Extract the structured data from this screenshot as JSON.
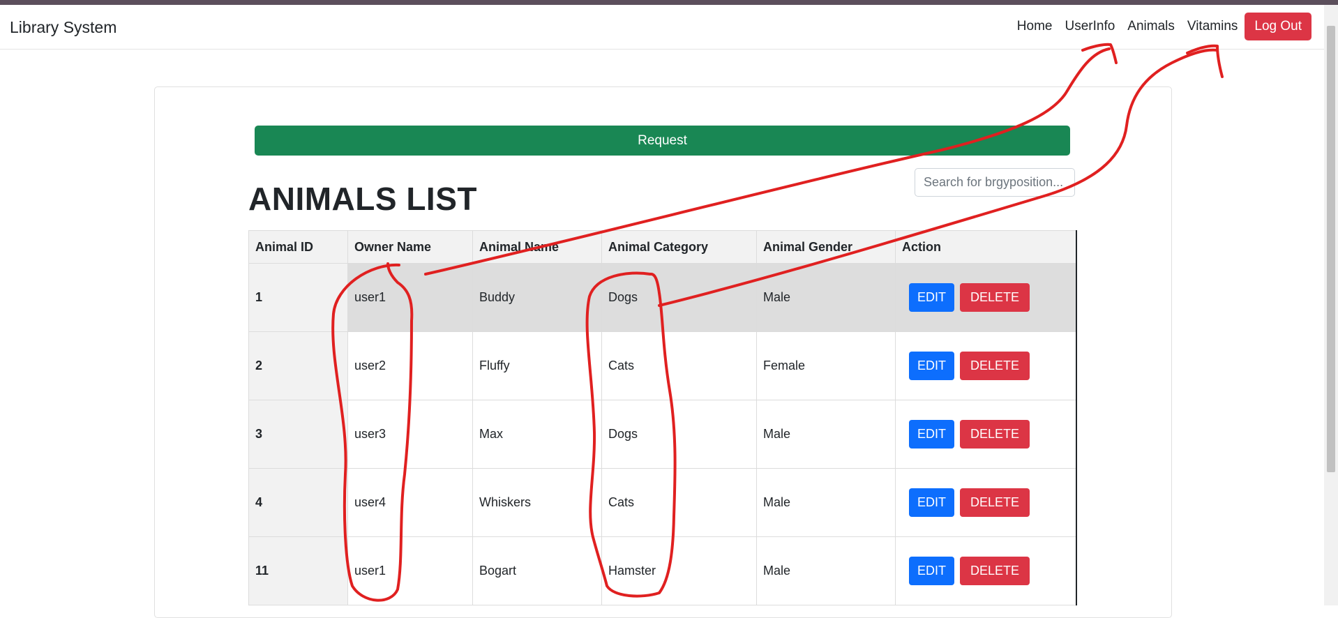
{
  "app": {
    "brand": "Library System"
  },
  "nav": {
    "links": [
      "Home",
      "UserInfo",
      "Animals",
      "Vitamins"
    ],
    "logout_label": "Log Out"
  },
  "main": {
    "request_label": "Request",
    "title": "ANIMALS LIST",
    "search_placeholder": "Search for brgyposition..."
  },
  "table": {
    "headers": [
      "Animal ID",
      "Owner Name",
      "Animal Name",
      "Animal Category",
      "Animal Gender",
      "Action"
    ],
    "rows": [
      {
        "id": "1",
        "owner": "user1",
        "name": "Buddy",
        "category": "Dogs",
        "gender": "Male"
      },
      {
        "id": "2",
        "owner": "user2",
        "name": "Fluffy",
        "category": "Cats",
        "gender": "Female"
      },
      {
        "id": "3",
        "owner": "user3",
        "name": "Max",
        "category": "Dogs",
        "gender": "Male"
      },
      {
        "id": "4",
        "owner": "user4",
        "name": "Whiskers",
        "category": "Cats",
        "gender": "Male"
      },
      {
        "id": "11",
        "owner": "user1",
        "name": "Bogart",
        "category": "Hamster",
        "gender": "Male"
      }
    ],
    "edit_label": "EDIT",
    "delete_label": "DELETE"
  },
  "colors": {
    "request_green": "#198754",
    "edit_blue": "#0d6efd",
    "delete_red": "#dc3545",
    "annotation_red": "#e02020"
  }
}
